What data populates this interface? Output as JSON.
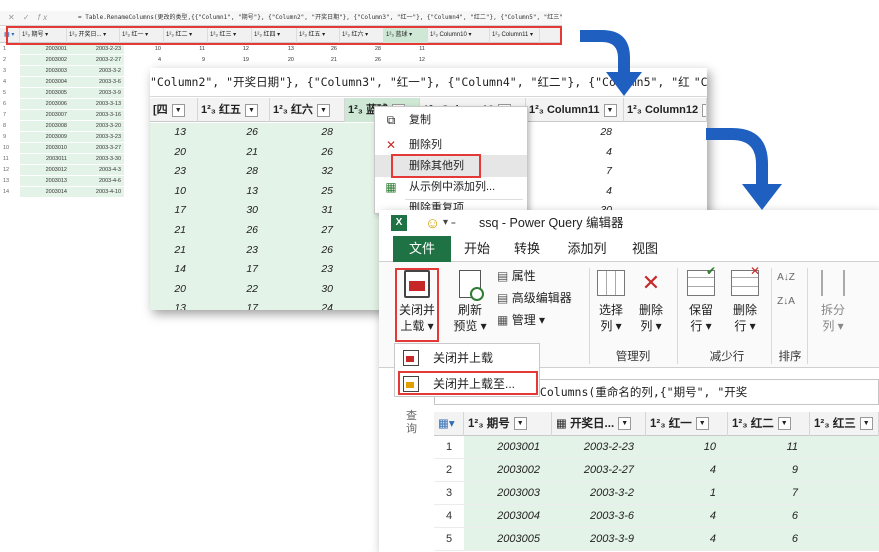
{
  "panel1": {
    "formula": "= Table.RenameColumns(更改的类型,{{\"Column1\", \"期号\"}, {\"Column2\", \"开奖日期\"}, {\"Column3\", \"红一\"}, {\"Column4\", \"红二\"}, {\"Column5\", \"红三\"}, {\"Column6\",",
    "fx": "fx",
    "headers": [
      "期号",
      "开奖日...",
      "红一",
      "红二",
      "红三",
      "红四",
      "红五",
      "红六",
      "蓝球",
      "Column10",
      "Column11"
    ],
    "rows": [
      {
        "n": "1",
        "id": "2003001",
        "date": "2003-2-23",
        "v": [
          "10",
          "11",
          "12",
          "13",
          "26",
          "28",
          "11"
        ]
      },
      {
        "n": "2",
        "id": "2003002",
        "date": "2003-2-27",
        "v": [
          "4",
          "9",
          "19",
          "20",
          "21",
          "26",
          "12"
        ]
      },
      {
        "n": "3",
        "id": "2003003",
        "date": "2003-3-2",
        "v": [
          "1",
          "7",
          "10",
          "23",
          "28",
          "32",
          "16"
        ]
      },
      {
        "n": "4",
        "id": "2003004",
        "date": "2003-3-6",
        "v": [
          "4",
          "6",
          "7",
          "10",
          "13",
          "25",
          "3"
        ]
      },
      {
        "n": "5",
        "id": "2003005",
        "date": "2003-3-9",
        "v": [
          "",
          "",
          "",
          "",
          "",
          "",
          ""
        ]
      },
      {
        "n": "6",
        "id": "2003006",
        "date": "2003-3-13",
        "v": [
          "",
          "",
          "",
          "",
          "",
          "",
          ""
        ]
      },
      {
        "n": "7",
        "id": "2003007",
        "date": "2003-3-16",
        "v": [
          "",
          "",
          "",
          "",
          "",
          "",
          ""
        ]
      },
      {
        "n": "8",
        "id": "2003008",
        "date": "2003-3-20",
        "v": [
          "",
          "",
          "",
          "",
          "",
          "",
          ""
        ]
      },
      {
        "n": "9",
        "id": "2003009",
        "date": "2003-3-23",
        "v": [
          "",
          "",
          "",
          "",
          "",
          "",
          ""
        ]
      },
      {
        "n": "10",
        "id": "2003010",
        "date": "2003-3-27",
        "v": [
          "",
          "",
          "",
          "",
          "",
          "",
          ""
        ]
      },
      {
        "n": "11",
        "id": "2003011",
        "date": "2003-3-30",
        "v": [
          "",
          "",
          "",
          "",
          "",
          "",
          ""
        ]
      },
      {
        "n": "12",
        "id": "2003012",
        "date": "2003-4-3",
        "v": [
          "",
          "",
          "",
          "",
          "",
          "",
          ""
        ]
      },
      {
        "n": "13",
        "id": "2003013",
        "date": "2003-4-6",
        "v": [
          "",
          "",
          "",
          "",
          "",
          "",
          ""
        ]
      },
      {
        "n": "14",
        "id": "2003014",
        "date": "2003-4-10",
        "v": [
          "",
          "",
          "",
          "",
          "",
          "",
          ""
        ]
      }
    ]
  },
  "panel2": {
    "formula": "\"Column2\", \"开奖日期\"}, {\"Column3\", \"红一\"}, {\"Column4\", \"红二\"}, {\"Column5\", \"红",
    "formula_tail": "\"Column",
    "headers": [
      "[四",
      "红五",
      "红六",
      "蓝球",
      "Column10",
      "Column11",
      "Column12"
    ],
    "col_red4": [
      "13",
      "20",
      "23",
      "10",
      "17",
      "21",
      "21",
      "14",
      "20",
      "13"
    ],
    "col_red5": [
      "26",
      "21",
      "28",
      "13",
      "30",
      "26",
      "23",
      "17",
      "22",
      "17"
    ],
    "col_red6": [
      "28",
      "26",
      "32",
      "25",
      "31",
      "27",
      "26",
      "23",
      "30",
      "24"
    ],
    "col_c11": [
      "28",
      "4",
      "7",
      "4",
      "30",
      "",
      "",
      "",
      "",
      ""
    ]
  },
  "context_menu": {
    "items": [
      {
        "label": "复制",
        "icon": "copy-icon"
      },
      {
        "label": "删除列",
        "icon": "delete-x-icon"
      },
      {
        "label": "删除其他列",
        "icon": ""
      },
      {
        "label": "从示例中添加列...",
        "icon": "add-column-example-icon"
      },
      {
        "label": "删除重复项",
        "icon": ""
      }
    ]
  },
  "panel3": {
    "title": "ssq - Power Query 编辑器",
    "tabs": [
      "文件",
      "开始",
      "转换",
      "添加列",
      "视图"
    ],
    "ribbon": {
      "close_load": "关闭并",
      "close_load2": "上载",
      "refresh": "刷新",
      "refresh2": "预览",
      "properties": "属性",
      "advanced_editor": "高级编辑器",
      "manage": "管理",
      "choose_cols": "选择",
      "choose_cols2": "列",
      "remove_cols": "删除",
      "remove_cols2": "列",
      "keep_rows": "保留",
      "keep_rows2": "行",
      "remove_rows": "删除",
      "remove_rows2": "行",
      "split": "拆分",
      "split2": "列",
      "group_manage_cols": "管理列",
      "group_reduce_rows": "减少行",
      "group_sort": "排序"
    },
    "dropdown": [
      "关闭并上载",
      "关闭并上载至..."
    ],
    "formula": "= Table.SelectColumns(重命名的列,{\"期号\", \"开奖",
    "query_pane": "查询",
    "grid_headers": [
      "期号",
      "开奖日...",
      "红一",
      "红二",
      "红三"
    ],
    "grid_rows": [
      {
        "n": "1",
        "id": "2003001",
        "date": "2003-2-23",
        "r1": "10",
        "r2": "11"
      },
      {
        "n": "2",
        "id": "2003002",
        "date": "2003-2-27",
        "r1": "4",
        "r2": "9"
      },
      {
        "n": "3",
        "id": "2003003",
        "date": "2003-3-2",
        "r1": "1",
        "r2": "7"
      },
      {
        "n": "4",
        "id": "2003004",
        "date": "2003-3-6",
        "r1": "4",
        "r2": "6"
      },
      {
        "n": "5",
        "id": "2003005",
        "date": "2003-3-9",
        "r1": "4",
        "r2": "6"
      }
    ]
  },
  "colors": {
    "excel_green": "#1f7244",
    "cell_green": "#e4f3e7",
    "highlight_red": "#e53935",
    "arrow_blue": "#1f5fbf"
  }
}
